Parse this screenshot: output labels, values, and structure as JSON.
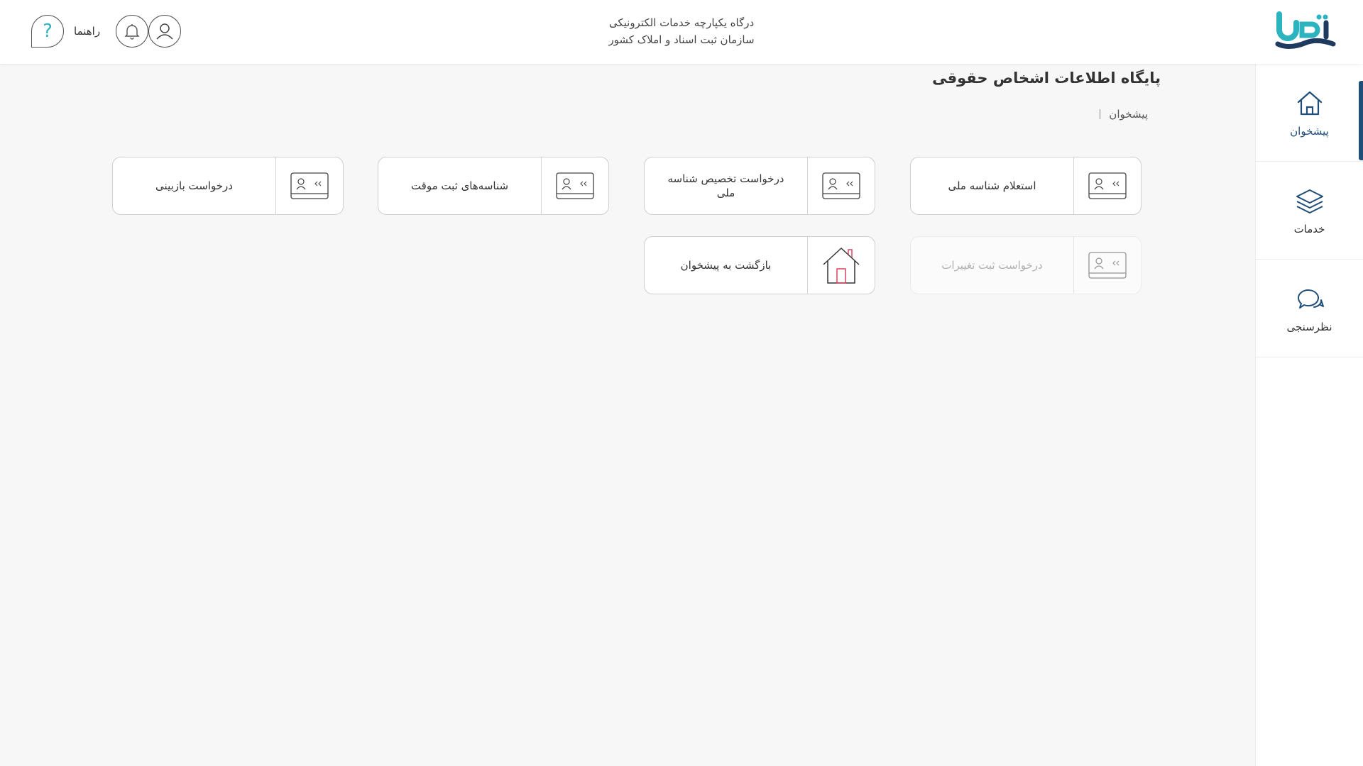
{
  "header": {
    "title_line1": "درگاه یکپارچه خدمات الکترونیکی",
    "title_line2": "سازمان ثبت اسناد و املاک کشور",
    "help_label": "راهنما",
    "logo_text": "ثبت من",
    "help_icon": "question-mark-icon",
    "notification_icon": "bell-icon",
    "profile_icon": "user-icon"
  },
  "sidebar": {
    "items": [
      {
        "label": "پیشخوان",
        "icon": "home-icon"
      },
      {
        "label": "خدمات",
        "icon": "layers-icon"
      },
      {
        "label": "نظرسنجی",
        "icon": "chat-bubbles-icon"
      }
    ]
  },
  "page": {
    "title": "پایگاه اطلاعات اشخاص حقوقی",
    "breadcrumb": "پیشخوان"
  },
  "cards": [
    {
      "label": "استعلام شناسه ملی",
      "icon": "id-card-icon",
      "enabled": true
    },
    {
      "label": "درخواست تخصیص شناسه ملی",
      "icon": "id-card-icon",
      "enabled": true
    },
    {
      "label": "شناسه‌های ثبت موقت",
      "icon": "id-card-icon",
      "enabled": true
    },
    {
      "label": "درخواست بازبینی",
      "icon": "id-card-icon",
      "enabled": true
    },
    {
      "label": "درخواست ثبت تغییرات",
      "icon": "id-card-icon",
      "enabled": false
    },
    {
      "label": "بازگشت به پیشخوان",
      "icon": "house-icon",
      "enabled": true
    }
  ],
  "colors": {
    "accent": "#1f4e79",
    "logo_teal": "#2bb3c0",
    "logo_navy": "#1f3a5f",
    "house_red": "#d6455d"
  }
}
